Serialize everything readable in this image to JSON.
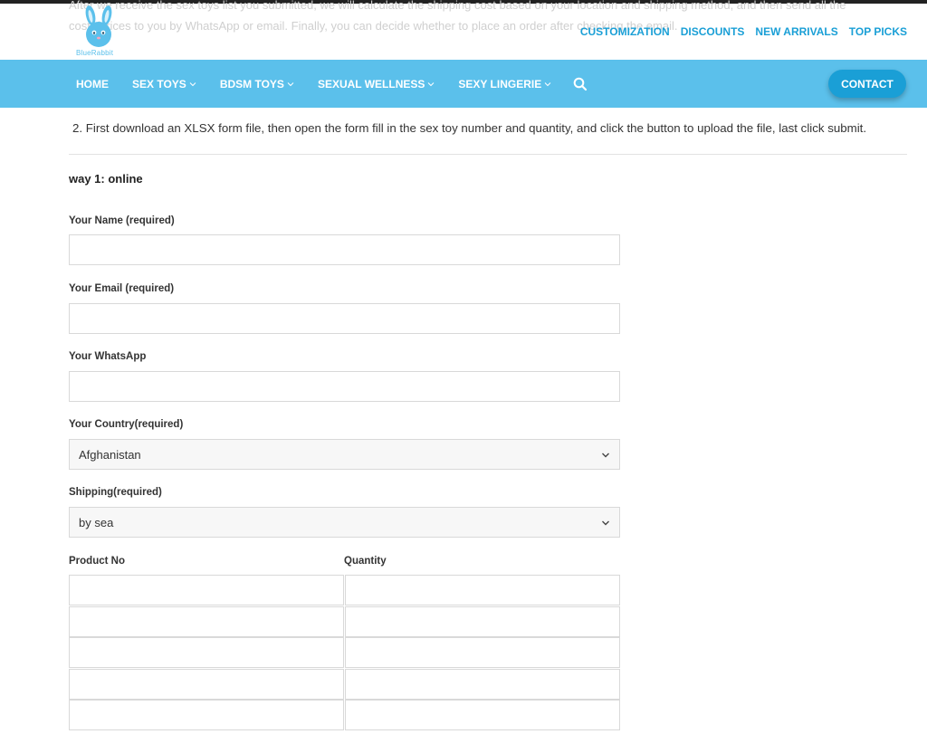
{
  "header": {
    "faded_lines": [
      "After we receive the sex toys list you submitted, we will calculate the shipping cost based on your location and shipping method, and then send all the",
      "costs/prices to you by WhatsApp or email. Finally, you can decide whether to place an order after checking the email."
    ],
    "logo_text": "BlueRabbit",
    "top_links": [
      "CUSTOMIZATION",
      "DISCOUNTS",
      "NEW ARRIVALS",
      "TOP PICKS"
    ],
    "brand_color": "#5bc0eb",
    "accent_color": "#1a9fd6"
  },
  "nav": {
    "items": [
      "HOME",
      "SEX TOYS",
      "BDSM TOYS",
      "SEXUAL WELLNESS",
      "SEXY LINGERIE"
    ],
    "has_dropdown": [
      false,
      true,
      true,
      true,
      true
    ],
    "search_icon": "search-icon",
    "contact_label": "CONTACT"
  },
  "main": {
    "intro": "2. First download an XLSX form file, then open the form fill in the sex toy number and quantity, and click the button to upload the file, last click submit.",
    "section_title": "way 1: online",
    "form": {
      "name_label": "Your Name (required)",
      "name_value": "",
      "email_label": "Your Email (required)",
      "email_value": "",
      "whatsapp_label": "Your WhatsApp",
      "whatsapp_value": "",
      "country_label": "Your Country(required)",
      "country_value": "Afghanistan",
      "shipping_label": "Shipping(required)",
      "shipping_value": "by sea"
    },
    "products": {
      "headers": [
        "Product No",
        "Quantity"
      ],
      "rows": [
        [
          "",
          ""
        ],
        [
          "",
          ""
        ],
        [
          "",
          ""
        ],
        [
          "",
          ""
        ],
        [
          "",
          ""
        ]
      ]
    }
  }
}
